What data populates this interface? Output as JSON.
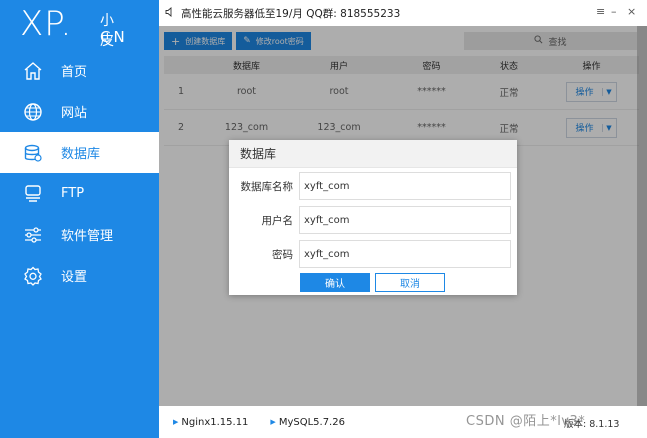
{
  "logo": {
    "main": "XP.",
    "small": "小皮",
    "cn": "CN"
  },
  "sidebar": {
    "items": [
      {
        "label": "首页",
        "icon": "home-icon"
      },
      {
        "label": "网站",
        "icon": "globe-icon"
      },
      {
        "label": "数据库",
        "icon": "database-icon",
        "active": true
      },
      {
        "label": "FTP",
        "icon": "server-icon"
      },
      {
        "label": "软件管理",
        "icon": "sliders-icon"
      },
      {
        "label": "设置",
        "icon": "gear-icon"
      }
    ]
  },
  "topbar": {
    "notice": "高性能云服务器低至19/月  QQ群: 818555233",
    "menu": "≡",
    "minimize": "–",
    "close": "×"
  },
  "toolbar": {
    "create_db": "创建数据库",
    "change_root_pw": "修改root密码",
    "search_placeholder": "查找"
  },
  "table": {
    "headers": [
      "",
      "数据库",
      "用户",
      "密码",
      "状态",
      "操作"
    ],
    "rows": [
      {
        "index": "1",
        "database": "root",
        "user": "root",
        "password": "******",
        "status": "正常",
        "action": "操作"
      },
      {
        "index": "2",
        "database": "123_com",
        "user": "123_com",
        "password": "******",
        "status": "正常",
        "action": "操作"
      }
    ]
  },
  "modal": {
    "title": "数据库",
    "fields": [
      {
        "label": "数据库名称",
        "value": "xyft_com"
      },
      {
        "label": "用户名",
        "value": "xyft_com"
      },
      {
        "label": "密码",
        "value": "xyft_com"
      }
    ],
    "confirm": "确认",
    "cancel": "取消"
  },
  "statusbar": {
    "nginx": "Nginx1.15.11",
    "mysql": "MySQL5.7.26",
    "version": "版本: 8.1.13"
  },
  "watermark": "CSDN @陌上*lv3*",
  "colors": {
    "accent": "#1e88e5",
    "sidebar_bg": "#1e88e5"
  }
}
